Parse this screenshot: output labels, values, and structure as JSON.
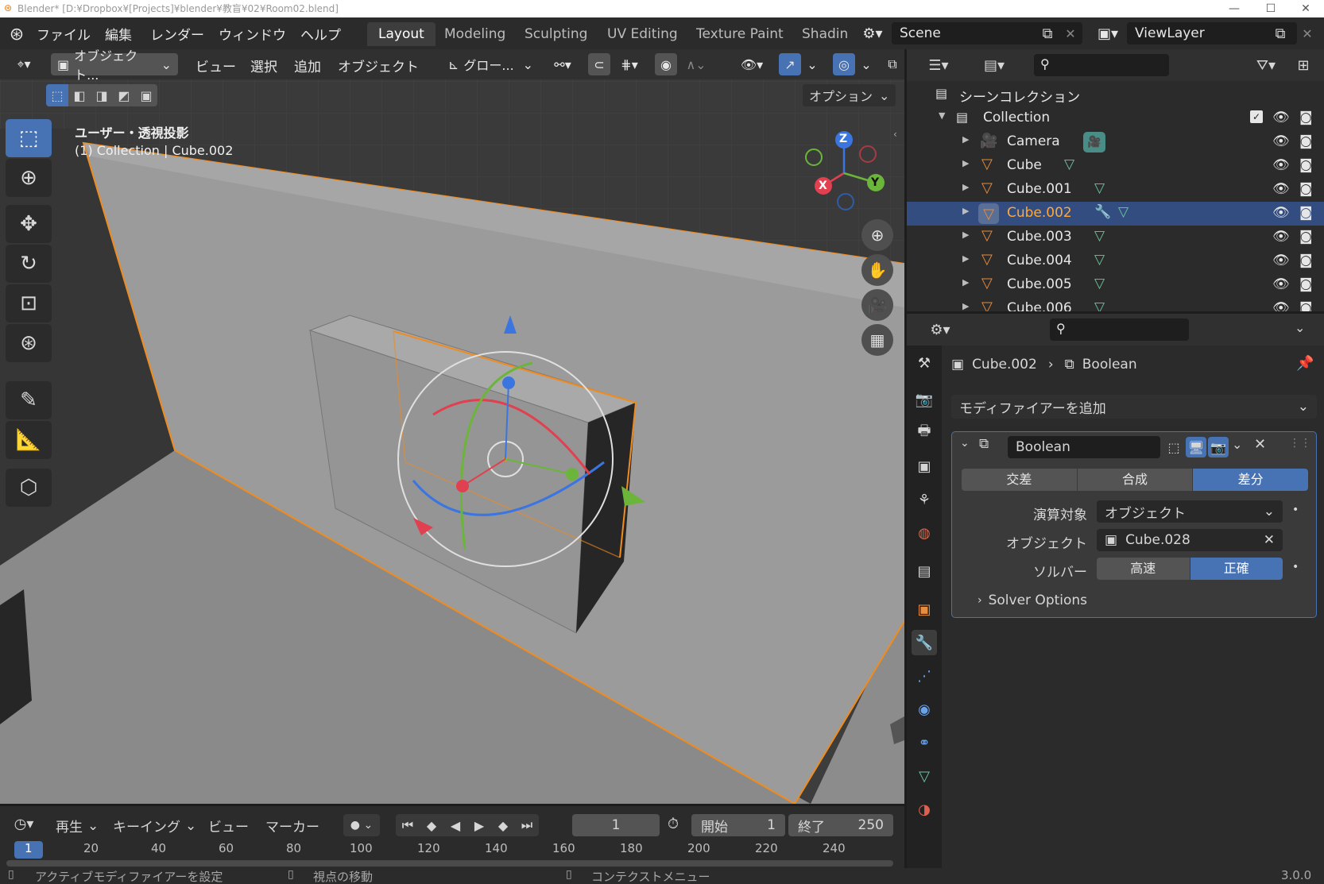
{
  "title_bar": {
    "title": "Blender* [D:¥Dropbox¥[Projects]¥blender¥教盲¥02¥Room02.blend]"
  },
  "menubar": {
    "items": [
      "ファイル",
      "編集",
      "レンダー",
      "ウィンドウ",
      "ヘルプ"
    ],
    "workspaces": [
      "Layout",
      "Modeling",
      "Sculpting",
      "UV Editing",
      "Texture Paint",
      "Shadin"
    ],
    "active_workspace": "Layout",
    "scene": "Scene",
    "view_layer": "ViewLayer"
  },
  "viewport_header": {
    "mode": "オブジェクト...",
    "menus": [
      "ビュー",
      "選択",
      "追加",
      "オブジェクト"
    ],
    "transform": "グロー...",
    "options": "オプション"
  },
  "viewport": {
    "view_name": "ユーザー・透視投影",
    "context": "(1) Collection | Cube.002",
    "axes": {
      "x": "X",
      "y": "Y",
      "z": "Z"
    }
  },
  "outliner": {
    "scene_collection": "シーンコレクション",
    "collection": "Collection",
    "objects": [
      {
        "name": "Camera",
        "selected": false
      },
      {
        "name": "Cube",
        "selected": false
      },
      {
        "name": "Cube.001",
        "selected": false
      },
      {
        "name": "Cube.002",
        "selected": true
      },
      {
        "name": "Cube.003",
        "selected": false
      },
      {
        "name": "Cube.004",
        "selected": false
      },
      {
        "name": "Cube.005",
        "selected": false
      },
      {
        "name": "Cube.006",
        "selected": false
      }
    ]
  },
  "properties": {
    "breadcrumb_object": "Cube.002",
    "breadcrumb_modifier": "Boolean",
    "add_modifier": "モディファイアーを追加",
    "modifier_name": "Boolean",
    "operations": [
      "交差",
      "合成",
      "差分"
    ],
    "active_operation": "差分",
    "operand_label": "演算対象",
    "operand_value": "オブジェクト",
    "object_label": "オブジェクト",
    "object_value": "Cube.028",
    "solver_label": "ソルバー",
    "solvers": [
      "高速",
      "正確"
    ],
    "active_solver": "正確",
    "solver_options": "Solver Options"
  },
  "timeline": {
    "menus": [
      "再生",
      "キーイング",
      "ビュー",
      "マーカー"
    ],
    "current_frame": "1",
    "start_label": "開始",
    "start": "1",
    "end_label": "終了",
    "end": "250",
    "ticks": [
      "1",
      "20",
      "40",
      "60",
      "80",
      "100",
      "120",
      "140",
      "160",
      "180",
      "200",
      "220",
      "240"
    ]
  },
  "statusbar": {
    "left": "アクティブモディファイアーを設定",
    "middle": "視点の移動",
    "right": "コンテクストメニュー",
    "version": "3.0.0"
  }
}
